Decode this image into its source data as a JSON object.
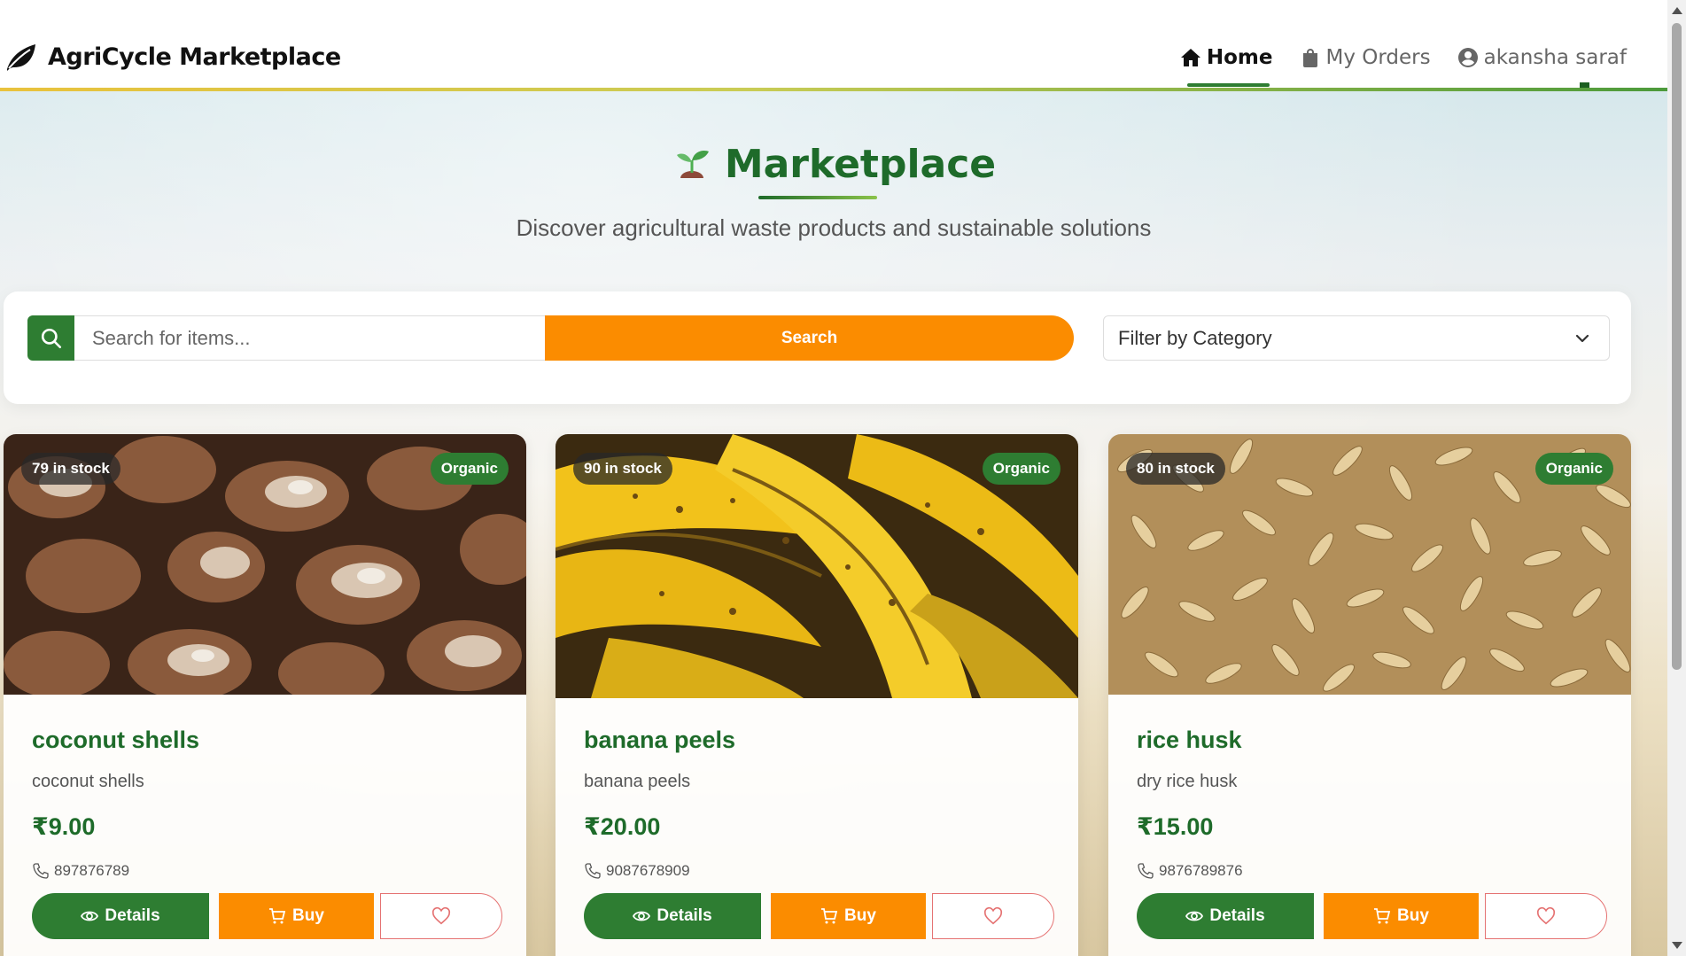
{
  "header": {
    "brand": "AgriCycle Marketplace",
    "nav": [
      {
        "label": "Home",
        "icon": "home-icon",
        "active": true
      },
      {
        "label": "My Orders",
        "icon": "shopping-bag-icon",
        "active": false
      },
      {
        "label": "akansha saraf",
        "icon": "user-circle-icon",
        "active": false
      }
    ]
  },
  "hero": {
    "title": "Marketplace",
    "subtitle": "Discover agricultural waste products and sustainable solutions",
    "icon": "seedling-icon"
  },
  "search": {
    "placeholder": "Search for items...",
    "value": "",
    "button_label": "Search",
    "category_label": "Filter by Category"
  },
  "products": [
    {
      "name": "coconut shells",
      "description": "coconut shells",
      "price": "₹9.00",
      "phone": "897876789",
      "stock": "79 in stock",
      "badge": "Organic",
      "details_label": "Details",
      "buy_label": "Buy"
    },
    {
      "name": "banana peels",
      "description": "banana peels",
      "price": "₹20.00",
      "phone": "9087678909",
      "stock": "90 in stock",
      "badge": "Organic",
      "details_label": "Details",
      "buy_label": "Buy"
    },
    {
      "name": "rice husk",
      "description": "dry rice husk",
      "price": "₹15.00",
      "phone": "9876789876",
      "stock": "80 in stock",
      "badge": "Organic",
      "details_label": "Details",
      "buy_label": "Buy"
    }
  ],
  "colors": {
    "primary_green": "#2e7d32",
    "title_green": "#1e6b2a",
    "accent_orange": "#fb8c00",
    "favorite_red": "#e57373"
  }
}
